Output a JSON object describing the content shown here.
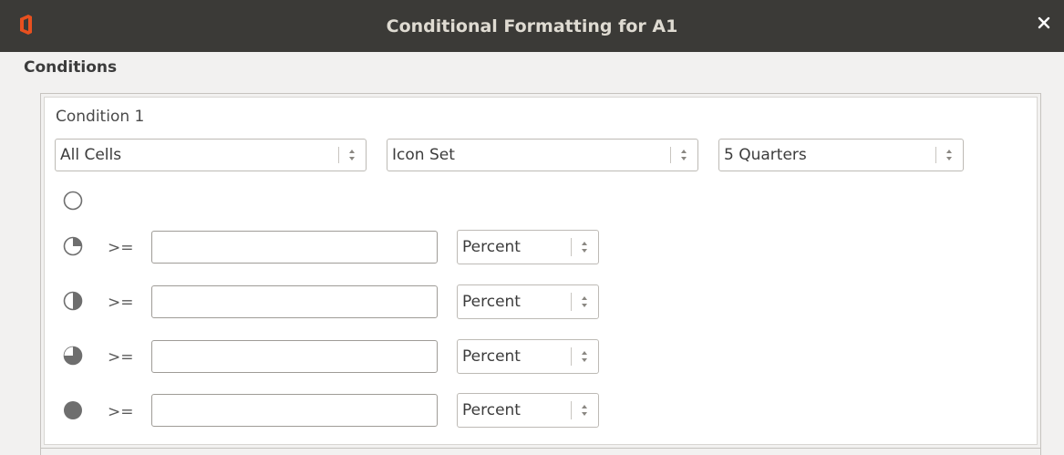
{
  "window": {
    "title": "Conditional Formatting for A1"
  },
  "section": {
    "label": "Conditions"
  },
  "condition": {
    "label": "Condition 1",
    "scope_select": "All Cells",
    "type_select": "Icon Set",
    "iconset_select": "5 Quarters"
  },
  "rows": [
    {
      "icon": "quarter-0-icon"
    },
    {
      "icon": "quarter-1-icon",
      "operator": ">=",
      "value": "",
      "unit": "Percent"
    },
    {
      "icon": "quarter-2-icon",
      "operator": ">=",
      "value": "",
      "unit": "Percent"
    },
    {
      "icon": "quarter-3-icon",
      "operator": ">=",
      "value": "",
      "unit": "Percent"
    },
    {
      "icon": "quarter-4-icon",
      "operator": ">=",
      "value": "",
      "unit": "Percent"
    }
  ],
  "colors": {
    "titlebar": "#3b3a37",
    "title_text": "#dfdbd2",
    "app_icon": "#e8501f",
    "icon_fill": "#6e6e6e"
  }
}
